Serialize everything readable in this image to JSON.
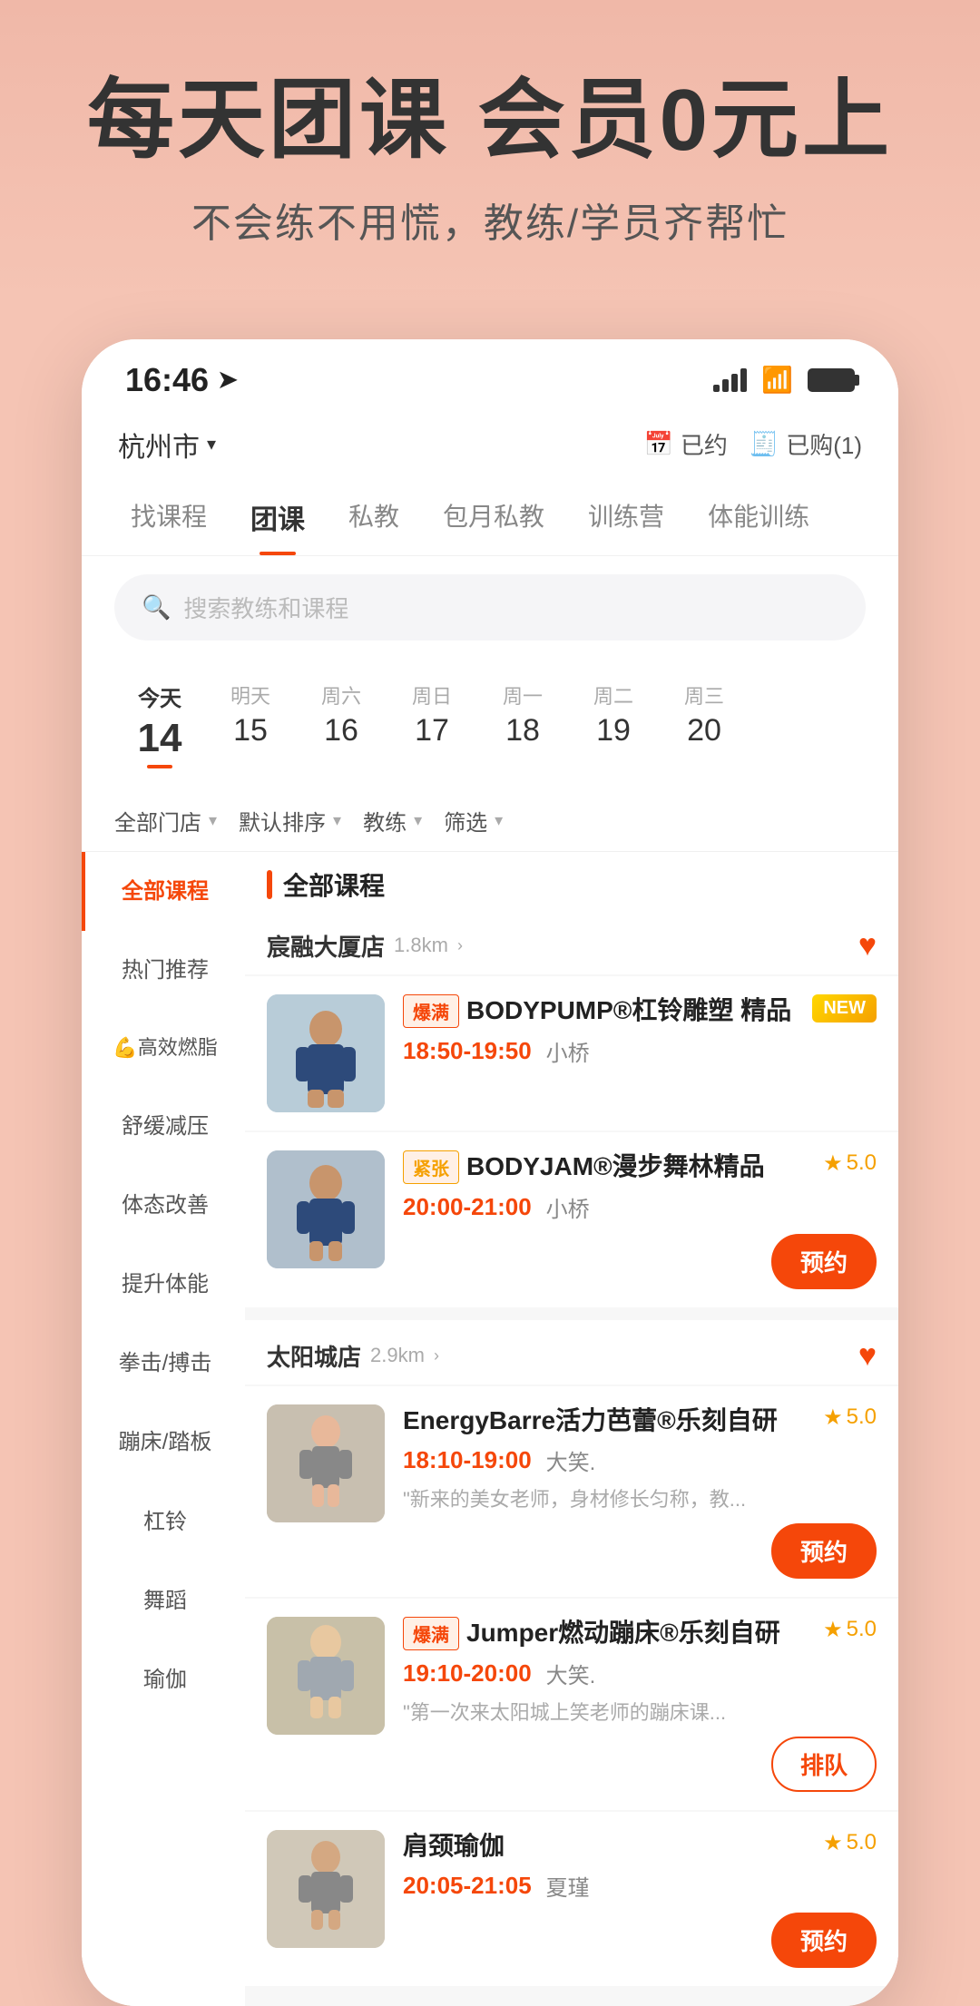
{
  "hero": {
    "title": "每天团课 会员0元上",
    "subtitle": "不会练不用慌，教练/学员齐帮忙"
  },
  "status_bar": {
    "time": "16:46",
    "location_icon": "➤"
  },
  "header": {
    "city": "杭州市",
    "dropdown_icon": "▾",
    "btn_scheduled": "已约",
    "btn_purchased": "已购(1)"
  },
  "nav_tabs": [
    {
      "label": "找课程",
      "active": false
    },
    {
      "label": "团课",
      "active": true
    },
    {
      "label": "私教",
      "active": false
    },
    {
      "label": "包月私教",
      "active": false
    },
    {
      "label": "训练营",
      "active": false
    },
    {
      "label": "体能训练",
      "active": false
    }
  ],
  "search": {
    "placeholder": "搜索教练和课程"
  },
  "dates": [
    {
      "label": "今天",
      "num": "14",
      "active": true
    },
    {
      "label": "明天",
      "num": "15",
      "active": false
    },
    {
      "label": "周六",
      "num": "16",
      "active": false
    },
    {
      "label": "周日",
      "num": "17",
      "active": false
    },
    {
      "label": "周一",
      "num": "18",
      "active": false
    },
    {
      "label": "周二",
      "num": "19",
      "active": false
    },
    {
      "label": "周三",
      "num": "20",
      "active": false
    }
  ],
  "filters": [
    {
      "label": "全部门店"
    },
    {
      "label": "默认排序"
    },
    {
      "label": "教练"
    },
    {
      "label": "筛选"
    }
  ],
  "sidebar": {
    "items": [
      {
        "label": "全部课程",
        "active": true,
        "icon": ""
      },
      {
        "label": "热门推荐",
        "active": false,
        "icon": ""
      },
      {
        "label": "💪高效燃脂",
        "active": false,
        "icon": ""
      },
      {
        "label": "舒缓减压",
        "active": false,
        "icon": ""
      },
      {
        "label": "体态改善",
        "active": false,
        "icon": ""
      },
      {
        "label": "提升体能",
        "active": false,
        "icon": ""
      },
      {
        "label": "拳击/搏击",
        "active": false,
        "icon": ""
      },
      {
        "label": "蹦床/踏板",
        "active": false,
        "icon": ""
      },
      {
        "label": "杠铃",
        "active": false,
        "icon": ""
      },
      {
        "label": "舞蹈",
        "active": false,
        "icon": ""
      },
      {
        "label": "瑜伽",
        "active": false,
        "icon": ""
      }
    ]
  },
  "stores": [
    {
      "name": "宸融大厦店",
      "distance": "1.8km",
      "favorited": true,
      "courses": [
        {
          "tag": "爆满",
          "tag_type": "full",
          "name": "BODYPUMP®杠铃雕塑 精品",
          "badge": "NEW",
          "time": "18:50-19:50",
          "teacher": "小桥",
          "rating": null,
          "action": null,
          "desc": null,
          "img_bg": "#b8ccd8"
        },
        {
          "tag": "紧张",
          "tag_type": "tight",
          "name": "BODYJAM®漫步舞林精品",
          "badge": null,
          "time": "20:00-21:00",
          "teacher": "小桥",
          "rating": "5.0",
          "action": "预约",
          "desc": null,
          "img_bg": "#b0bfcc"
        }
      ]
    },
    {
      "name": "太阳城店",
      "distance": "2.9km",
      "favorited": true,
      "courses": [
        {
          "tag": null,
          "tag_type": null,
          "name": "EnergyBarre活力芭蕾®乐刻自研",
          "badge": null,
          "time": "18:10-19:00",
          "teacher": "大笑.",
          "rating": "5.0",
          "action": "预约",
          "desc": "\"新来的美女老师，身材修长匀称，教...",
          "img_bg": "#c8bfb0"
        },
        {
          "tag": "爆满",
          "tag_type": "full",
          "name": "Jumper燃动蹦床®乐刻自研",
          "badge": null,
          "time": "19:10-20:00",
          "teacher": "大笑.",
          "rating": "5.0",
          "action": "排队",
          "action_outline": true,
          "desc": "\"第一次来太阳城上笑老师的蹦床课...",
          "img_bg": "#c8c0a8"
        },
        {
          "tag": null,
          "tag_type": null,
          "name": "肩颈瑜伽",
          "badge": null,
          "time": "20:05-21:05",
          "teacher": "夏瑾",
          "rating": "5.0",
          "action": "预约",
          "desc": null,
          "img_bg": "#d0c8b8"
        }
      ]
    }
  ],
  "all_courses_label": "全部课程"
}
